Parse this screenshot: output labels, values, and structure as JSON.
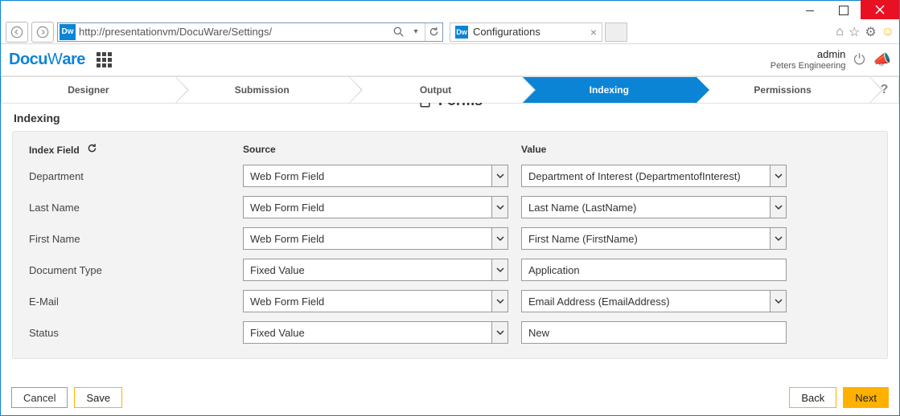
{
  "window": {
    "url": "http://presentationvm/DocuWare/Settings/",
    "tab_title": "Configurations"
  },
  "app": {
    "logo": "DocuWare",
    "module_title": "Forms",
    "user_name": "admin",
    "org_name": "Peters Engineering"
  },
  "wizard": {
    "steps": [
      "Designer",
      "Submission",
      "Output",
      "Indexing",
      "Permissions"
    ],
    "active_index": 3
  },
  "section": {
    "title": "Indexing",
    "headers": {
      "index_field": "Index Field",
      "source": "Source",
      "value": "Value"
    },
    "rows": [
      {
        "field": "Department",
        "source": "Web Form Field",
        "source_type": "select",
        "value": "Department of Interest (DepartmentofInterest)",
        "value_type": "select"
      },
      {
        "field": "Last Name",
        "source": "Web Form Field",
        "source_type": "select",
        "value": "Last Name (LastName)",
        "value_type": "select"
      },
      {
        "field": "First Name",
        "source": "Web Form Field",
        "source_type": "select",
        "value": "First Name (FirstName)",
        "value_type": "select"
      },
      {
        "field": "Document Type",
        "source": "Fixed Value",
        "source_type": "select",
        "value": "Application",
        "value_type": "text"
      },
      {
        "field": "E-Mail",
        "source": "Web Form Field",
        "source_type": "select",
        "value": "Email Address (EmailAddress)",
        "value_type": "select"
      },
      {
        "field": "Status",
        "source": "Fixed Value",
        "source_type": "select",
        "value": "New",
        "value_type": "text"
      }
    ]
  },
  "footer": {
    "cancel": "Cancel",
    "save": "Save",
    "back": "Back",
    "next": "Next"
  }
}
